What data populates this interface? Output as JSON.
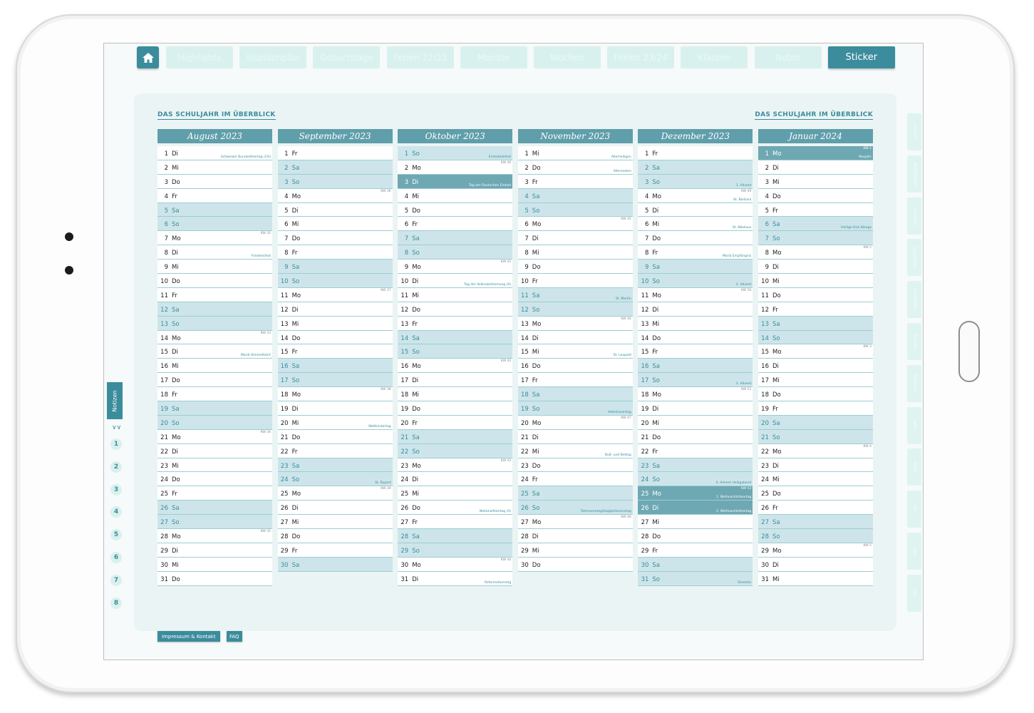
{
  "nav": {
    "tabs": [
      {
        "label": "Highlights",
        "active": false
      },
      {
        "label": "Stundenplan",
        "active": false
      },
      {
        "label": "Geburtstage",
        "active": false
      },
      {
        "label": "Ferien 22/23",
        "active": false
      },
      {
        "label": "Monate",
        "active": false
      },
      {
        "label": "Wochen",
        "active": false
      },
      {
        "label": "Ferien 23/24",
        "active": false
      },
      {
        "label": "Klassen",
        "active": false
      },
      {
        "label": "Noten",
        "active": false
      },
      {
        "label": "Sticker",
        "active": true
      }
    ]
  },
  "headings": {
    "left": "DAS SCHULJAHR IM ÜBERBLICK",
    "right": "DAS SCHULJAHR IM ÜBERBLICK"
  },
  "months": [
    {
      "title": "August 2023",
      "days": [
        {
          "d": "1",
          "n": "Di",
          "note": "Schweizer Bundesfeiertag (CH)"
        },
        {
          "d": "2",
          "n": "Mi"
        },
        {
          "d": "3",
          "n": "Do"
        },
        {
          "d": "4",
          "n": "Fr"
        },
        {
          "d": "5",
          "n": "Sa",
          "type": "weekend"
        },
        {
          "d": "6",
          "n": "So",
          "type": "weekend"
        },
        {
          "d": "7",
          "n": "Mo",
          "kw": "KW 32"
        },
        {
          "d": "8",
          "n": "Di",
          "note": "Friedensfest"
        },
        {
          "d": "9",
          "n": "Mi"
        },
        {
          "d": "10",
          "n": "Do"
        },
        {
          "d": "11",
          "n": "Fr"
        },
        {
          "d": "12",
          "n": "Sa",
          "type": "weekend"
        },
        {
          "d": "13",
          "n": "So",
          "type": "weekend"
        },
        {
          "d": "14",
          "n": "Mo",
          "kw": "KW 33"
        },
        {
          "d": "15",
          "n": "Di",
          "note": "Mariä Himmelfahrt"
        },
        {
          "d": "16",
          "n": "Mi"
        },
        {
          "d": "17",
          "n": "Do"
        },
        {
          "d": "18",
          "n": "Fr"
        },
        {
          "d": "19",
          "n": "Sa",
          "type": "weekend"
        },
        {
          "d": "20",
          "n": "So",
          "type": "weekend"
        },
        {
          "d": "21",
          "n": "Mo",
          "kw": "KW 34"
        },
        {
          "d": "22",
          "n": "Di"
        },
        {
          "d": "23",
          "n": "Mi"
        },
        {
          "d": "24",
          "n": "Do"
        },
        {
          "d": "25",
          "n": "Fr"
        },
        {
          "d": "26",
          "n": "Sa",
          "type": "weekend"
        },
        {
          "d": "27",
          "n": "So",
          "type": "weekend"
        },
        {
          "d": "28",
          "n": "Mo",
          "kw": "KW 35"
        },
        {
          "d": "29",
          "n": "Di"
        },
        {
          "d": "30",
          "n": "Mi"
        },
        {
          "d": "31",
          "n": "Do"
        }
      ]
    },
    {
      "title": "September 2023",
      "days": [
        {
          "d": "1",
          "n": "Fr"
        },
        {
          "d": "2",
          "n": "Sa",
          "type": "weekend"
        },
        {
          "d": "3",
          "n": "So",
          "type": "weekend"
        },
        {
          "d": "4",
          "n": "Mo",
          "kw": "KW 36"
        },
        {
          "d": "5",
          "n": "Di"
        },
        {
          "d": "6",
          "n": "Mi"
        },
        {
          "d": "7",
          "n": "Do"
        },
        {
          "d": "8",
          "n": "Fr"
        },
        {
          "d": "9",
          "n": "Sa",
          "type": "weekend"
        },
        {
          "d": "10",
          "n": "So",
          "type": "weekend"
        },
        {
          "d": "11",
          "n": "Mo",
          "kw": "KW 37"
        },
        {
          "d": "12",
          "n": "Di"
        },
        {
          "d": "13",
          "n": "Mi"
        },
        {
          "d": "14",
          "n": "Do"
        },
        {
          "d": "15",
          "n": "Fr"
        },
        {
          "d": "16",
          "n": "Sa",
          "type": "weekend"
        },
        {
          "d": "17",
          "n": "So",
          "type": "weekend"
        },
        {
          "d": "18",
          "n": "Mo",
          "kw": "KW 38"
        },
        {
          "d": "19",
          "n": "Di"
        },
        {
          "d": "20",
          "n": "Mi",
          "note": "Weltkindertag"
        },
        {
          "d": "21",
          "n": "Do"
        },
        {
          "d": "22",
          "n": "Fr"
        },
        {
          "d": "23",
          "n": "Sa",
          "type": "weekend"
        },
        {
          "d": "24",
          "n": "So",
          "type": "weekend",
          "note": "St. Rupert"
        },
        {
          "d": "25",
          "n": "Mo",
          "kw": "KW 39"
        },
        {
          "d": "26",
          "n": "Di"
        },
        {
          "d": "27",
          "n": "Mi"
        },
        {
          "d": "28",
          "n": "Do"
        },
        {
          "d": "29",
          "n": "Fr"
        },
        {
          "d": "30",
          "n": "Sa",
          "type": "weekend"
        }
      ]
    },
    {
      "title": "Oktober 2023",
      "days": [
        {
          "d": "1",
          "n": "So",
          "type": "weekend",
          "note": "Erntedankfest"
        },
        {
          "d": "2",
          "n": "Mo",
          "kw": "KW 40"
        },
        {
          "d": "3",
          "n": "Di",
          "type": "holiday",
          "note": "Tag der Deutschen Einheit"
        },
        {
          "d": "4",
          "n": "Mi"
        },
        {
          "d": "5",
          "n": "Do"
        },
        {
          "d": "6",
          "n": "Fr"
        },
        {
          "d": "7",
          "n": "Sa",
          "type": "weekend"
        },
        {
          "d": "8",
          "n": "So",
          "type": "weekend"
        },
        {
          "d": "9",
          "n": "Mo",
          "kw": "KW 41"
        },
        {
          "d": "10",
          "n": "Di",
          "note": "Tag der Volksabstimmung (A)"
        },
        {
          "d": "11",
          "n": "Mi"
        },
        {
          "d": "12",
          "n": "Do"
        },
        {
          "d": "13",
          "n": "Fr"
        },
        {
          "d": "14",
          "n": "Sa",
          "type": "weekend"
        },
        {
          "d": "15",
          "n": "So",
          "type": "weekend"
        },
        {
          "d": "16",
          "n": "Mo",
          "kw": "KW 42"
        },
        {
          "d": "17",
          "n": "Di"
        },
        {
          "d": "18",
          "n": "Mi"
        },
        {
          "d": "19",
          "n": "Do"
        },
        {
          "d": "20",
          "n": "Fr"
        },
        {
          "d": "21",
          "n": "Sa",
          "type": "weekend"
        },
        {
          "d": "22",
          "n": "So",
          "type": "weekend"
        },
        {
          "d": "23",
          "n": "Mo",
          "kw": "KW 43"
        },
        {
          "d": "24",
          "n": "Di"
        },
        {
          "d": "25",
          "n": "Mi"
        },
        {
          "d": "26",
          "n": "Do",
          "note": "Nationalfeiertag (A)"
        },
        {
          "d": "27",
          "n": "Fr"
        },
        {
          "d": "28",
          "n": "Sa",
          "type": "weekend"
        },
        {
          "d": "29",
          "n": "So",
          "type": "weekend"
        },
        {
          "d": "30",
          "n": "Mo",
          "kw": "KW 44"
        },
        {
          "d": "31",
          "n": "Di",
          "note": "Reformationstag"
        }
      ]
    },
    {
      "title": "November 2023",
      "days": [
        {
          "d": "1",
          "n": "Mi",
          "note": "Allerheiligen"
        },
        {
          "d": "2",
          "n": "Do",
          "note": "Allerseelen"
        },
        {
          "d": "3",
          "n": "Fr"
        },
        {
          "d": "4",
          "n": "Sa",
          "type": "weekend"
        },
        {
          "d": "5",
          "n": "So",
          "type": "weekend"
        },
        {
          "d": "6",
          "n": "Mo",
          "kw": "KW 45"
        },
        {
          "d": "7",
          "n": "Di"
        },
        {
          "d": "8",
          "n": "Mi"
        },
        {
          "d": "9",
          "n": "Do"
        },
        {
          "d": "10",
          "n": "Fr"
        },
        {
          "d": "11",
          "n": "Sa",
          "type": "weekend",
          "note": "St. Martin"
        },
        {
          "d": "12",
          "n": "So",
          "type": "weekend"
        },
        {
          "d": "13",
          "n": "Mo",
          "kw": "KW 46"
        },
        {
          "d": "14",
          "n": "Di"
        },
        {
          "d": "15",
          "n": "Mi",
          "note": "St. Leopold"
        },
        {
          "d": "16",
          "n": "Do"
        },
        {
          "d": "17",
          "n": "Fr"
        },
        {
          "d": "18",
          "n": "Sa",
          "type": "weekend"
        },
        {
          "d": "19",
          "n": "So",
          "type": "weekend",
          "note": "Volkstrauertag"
        },
        {
          "d": "20",
          "n": "Mo",
          "kw": "KW 47"
        },
        {
          "d": "21",
          "n": "Di"
        },
        {
          "d": "22",
          "n": "Mi",
          "note": "Buß- und Bettag"
        },
        {
          "d": "23",
          "n": "Do"
        },
        {
          "d": "24",
          "n": "Fr"
        },
        {
          "d": "25",
          "n": "Sa",
          "type": "weekend"
        },
        {
          "d": "26",
          "n": "So",
          "type": "weekend",
          "note": "Totensonntag/Ewigkeitssonntag"
        },
        {
          "d": "27",
          "n": "Mo",
          "kw": "KW 48"
        },
        {
          "d": "28",
          "n": "Di"
        },
        {
          "d": "29",
          "n": "Mi"
        },
        {
          "d": "30",
          "n": "Do"
        }
      ]
    },
    {
      "title": "Dezember 2023",
      "days": [
        {
          "d": "1",
          "n": "Fr"
        },
        {
          "d": "2",
          "n": "Sa",
          "type": "weekend"
        },
        {
          "d": "3",
          "n": "So",
          "type": "weekend",
          "note": "1. Advent"
        },
        {
          "d": "4",
          "n": "Mo",
          "kw": "KW 49",
          "note": "St. Barbara"
        },
        {
          "d": "5",
          "n": "Di"
        },
        {
          "d": "6",
          "n": "Mi",
          "note": "St. Nikolaus"
        },
        {
          "d": "7",
          "n": "Do"
        },
        {
          "d": "8",
          "n": "Fr",
          "note": "Mariä Empfängnis"
        },
        {
          "d": "9",
          "n": "Sa",
          "type": "weekend"
        },
        {
          "d": "10",
          "n": "So",
          "type": "weekend",
          "note": "2. Advent"
        },
        {
          "d": "11",
          "n": "Mo",
          "kw": "KW 50"
        },
        {
          "d": "12",
          "n": "Di"
        },
        {
          "d": "13",
          "n": "Mi"
        },
        {
          "d": "14",
          "n": "Do"
        },
        {
          "d": "15",
          "n": "Fr"
        },
        {
          "d": "16",
          "n": "Sa",
          "type": "weekend"
        },
        {
          "d": "17",
          "n": "So",
          "type": "weekend",
          "note": "3. Advent"
        },
        {
          "d": "18",
          "n": "Mo",
          "kw": "KW 51"
        },
        {
          "d": "19",
          "n": "Di"
        },
        {
          "d": "20",
          "n": "Mi"
        },
        {
          "d": "21",
          "n": "Do"
        },
        {
          "d": "22",
          "n": "Fr"
        },
        {
          "d": "23",
          "n": "Sa",
          "type": "weekend"
        },
        {
          "d": "24",
          "n": "So",
          "type": "weekend",
          "note": "4. Advent Heiligabend"
        },
        {
          "d": "25",
          "n": "Mo",
          "type": "holiday",
          "kw": "KW 52",
          "note": "1. Weihnachtsfeiertag"
        },
        {
          "d": "26",
          "n": "Di",
          "type": "holiday",
          "note": "2. Weihnachtsfeiertag"
        },
        {
          "d": "27",
          "n": "Mi"
        },
        {
          "d": "28",
          "n": "Do"
        },
        {
          "d": "29",
          "n": "Fr"
        },
        {
          "d": "30",
          "n": "Sa",
          "type": "weekend"
        },
        {
          "d": "31",
          "n": "So",
          "type": "weekend",
          "note": "Silvester"
        }
      ]
    },
    {
      "title": "Januar 2024",
      "days": [
        {
          "d": "1",
          "n": "Mo",
          "type": "holiday",
          "kw": "KW 1",
          "note": "Neujahr"
        },
        {
          "d": "2",
          "n": "Di"
        },
        {
          "d": "3",
          "n": "Mi"
        },
        {
          "d": "4",
          "n": "Do"
        },
        {
          "d": "5",
          "n": "Fr"
        },
        {
          "d": "6",
          "n": "Sa",
          "type": "weekend",
          "note": "Heilige Drei Könige"
        },
        {
          "d": "7",
          "n": "So",
          "type": "weekend"
        },
        {
          "d": "8",
          "n": "Mo",
          "kw": "KW 2"
        },
        {
          "d": "9",
          "n": "Di"
        },
        {
          "d": "10",
          "n": "Mi"
        },
        {
          "d": "11",
          "n": "Do"
        },
        {
          "d": "12",
          "n": "Fr"
        },
        {
          "d": "13",
          "n": "Sa",
          "type": "weekend"
        },
        {
          "d": "14",
          "n": "So",
          "type": "weekend"
        },
        {
          "d": "15",
          "n": "Mo",
          "kw": "KW 3"
        },
        {
          "d": "16",
          "n": "Di"
        },
        {
          "d": "17",
          "n": "Mi"
        },
        {
          "d": "18",
          "n": "Do"
        },
        {
          "d": "19",
          "n": "Fr"
        },
        {
          "d": "20",
          "n": "Sa",
          "type": "weekend"
        },
        {
          "d": "21",
          "n": "So",
          "type": "weekend"
        },
        {
          "d": "22",
          "n": "Mo",
          "kw": "KW 4"
        },
        {
          "d": "23",
          "n": "Di"
        },
        {
          "d": "24",
          "n": "Mi"
        },
        {
          "d": "25",
          "n": "Do"
        },
        {
          "d": "26",
          "n": "Fr"
        },
        {
          "d": "27",
          "n": "Sa",
          "type": "weekend"
        },
        {
          "d": "28",
          "n": "So",
          "type": "weekend"
        },
        {
          "d": "29",
          "n": "Mo",
          "kw": "KW 5"
        },
        {
          "d": "30",
          "n": "Di"
        },
        {
          "d": "31",
          "n": "Mi"
        }
      ]
    }
  ],
  "left_sidebar": {
    "notes_label": "Notizen",
    "numbers": [
      "1",
      "2",
      "3",
      "4",
      "5",
      "6",
      "7",
      "8"
    ]
  },
  "right_sidebar": {
    "tabs": [
      "AUGUST",
      "SEPTEMBER",
      "OKTOBER",
      "NOVEMBER",
      "DEZEMBER",
      "JANUAR",
      "FEBRUAR",
      "MÄRZ",
      "APRIL",
      "MAI",
      "JUNI",
      "JULI"
    ]
  },
  "footer": {
    "impressum": "Impressum & Kontakt",
    "faq": "FAQ"
  },
  "colors": {
    "accent": "#3b8c9c",
    "header": "#5f9eaa",
    "weekend": "#cde5ea",
    "holiday": "#6ea8b3",
    "tab_inactive": "#d9f1ee"
  }
}
